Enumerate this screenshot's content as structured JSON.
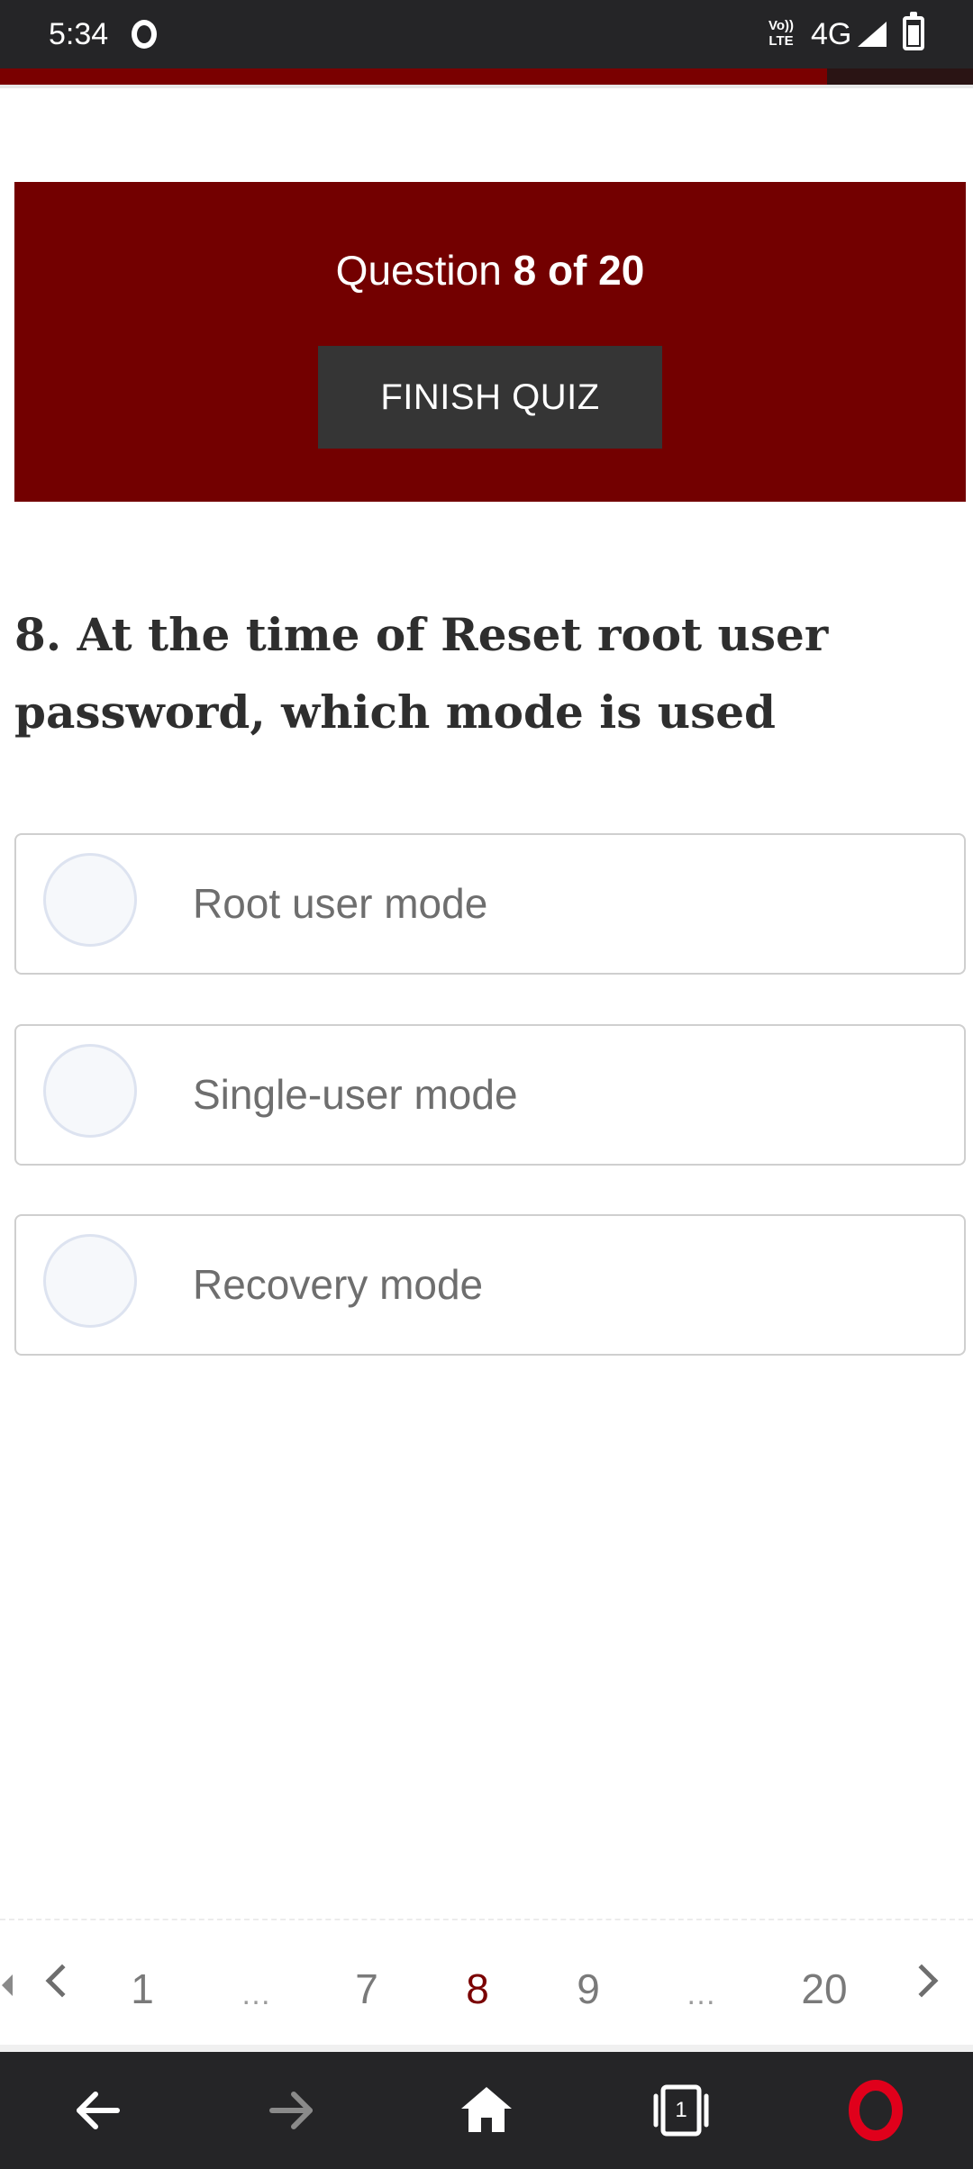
{
  "status_bar": {
    "time": "5:34",
    "volte_top": "Vo))",
    "volte_bottom": "LTE",
    "network": "4G"
  },
  "page_load_progress": 0.85,
  "quiz": {
    "question_prefix": "Question",
    "question_counter": "8 of 20",
    "finish_button": "FINISH QUIZ",
    "question_text": "8. At the time of Reset root user password, which mode is used",
    "options": [
      {
        "label": "Root user mode"
      },
      {
        "label": "Single-user mode"
      },
      {
        "label": "Recovery mode"
      }
    ]
  },
  "pagination": {
    "pages": [
      "1",
      "…",
      "7",
      "8",
      "9",
      "…",
      "20"
    ],
    "current_page": "8"
  },
  "browser_nav": {
    "tabs_count": "1",
    "icons": [
      "back-arrow-icon",
      "forward-arrow-icon",
      "home-icon",
      "tabs-icon",
      "opera-logo-icon"
    ]
  },
  "colors": {
    "accent": "#730000",
    "button": "#353535",
    "status_bar": "#252527",
    "current_page": "#7a0000"
  }
}
